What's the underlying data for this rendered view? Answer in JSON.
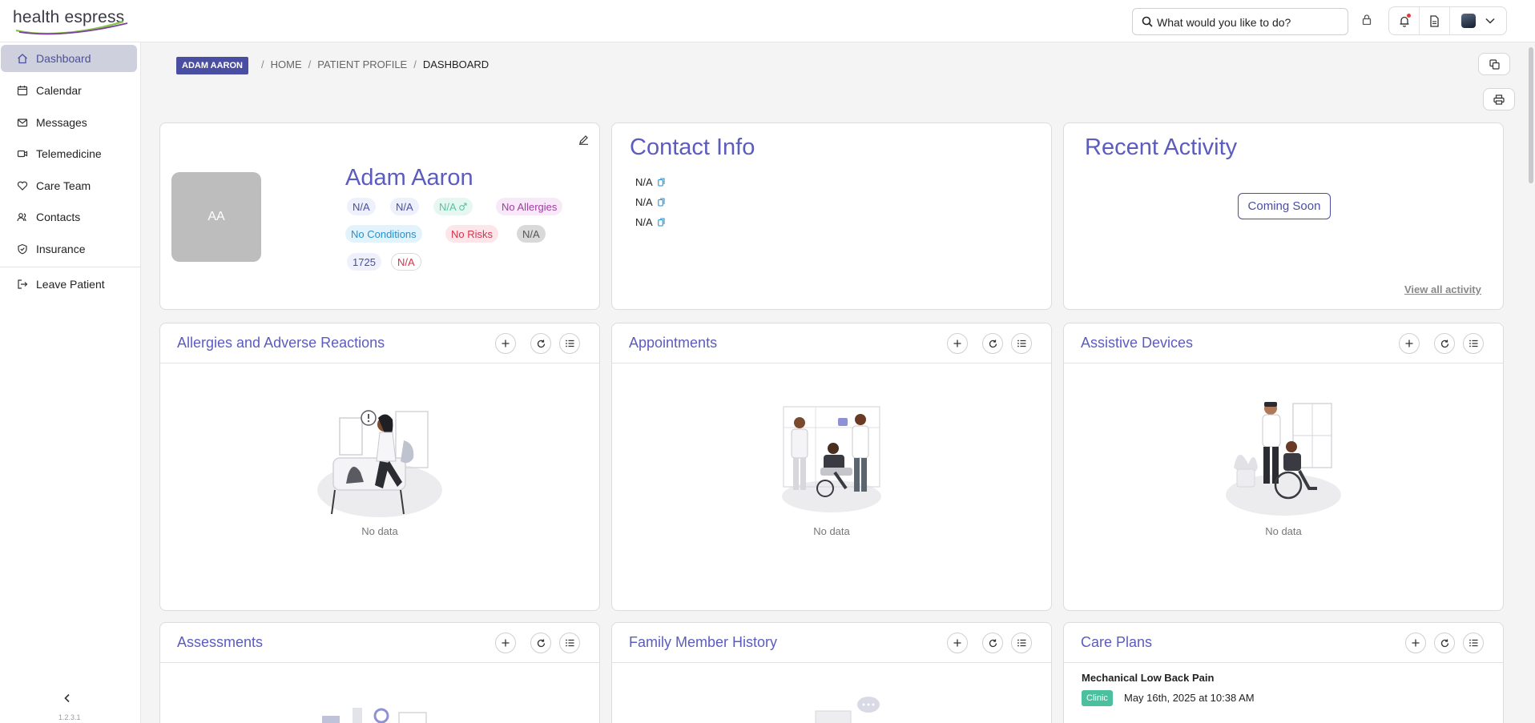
{
  "app": {
    "logo_text": "health espress",
    "version": "1.2.3.1"
  },
  "search": {
    "placeholder": "What would you like to do?"
  },
  "sidebar": {
    "items": [
      {
        "label": "Dashboard",
        "icon": "home-icon",
        "active": true
      },
      {
        "label": "Calendar",
        "icon": "calendar-icon"
      },
      {
        "label": "Messages",
        "icon": "mail-icon"
      },
      {
        "label": "Telemedicine",
        "icon": "video-icon"
      },
      {
        "label": "Care Team",
        "icon": "heart-icon"
      },
      {
        "label": "Contacts",
        "icon": "contacts-icon"
      },
      {
        "label": "Insurance",
        "icon": "shield-icon"
      }
    ],
    "leave": {
      "label": "Leave Patient",
      "icon": "exit-icon"
    }
  },
  "breadcrumb": {
    "patient_badge": "ADAM AARON",
    "items": [
      "HOME",
      "PATIENT PROFILE",
      "DASHBOARD"
    ]
  },
  "profile": {
    "initials": "AA",
    "name": "Adam Aaron",
    "chips": {
      "c1": "N/A",
      "c2": "N/A",
      "c3": "N/A",
      "allergies": "No Allergies",
      "conditions": "No Conditions",
      "risks": "No Risks",
      "c7": "N/A",
      "c8": "1725",
      "c9": "N/A"
    }
  },
  "contact_info": {
    "title": "Contact Info",
    "rows": [
      "N/A",
      "N/A",
      "N/A"
    ]
  },
  "recent_activity": {
    "title": "Recent Activity",
    "coming_soon": "Coming Soon",
    "view_all": "View all activity"
  },
  "widgets": {
    "allergies": {
      "title": "Allergies and Adverse Reactions",
      "empty": "No data"
    },
    "appointments": {
      "title": "Appointments",
      "empty": "No data"
    },
    "assistive": {
      "title": "Assistive Devices",
      "empty": "No data"
    },
    "assessments": {
      "title": "Assessments"
    },
    "family": {
      "title": "Family Member History"
    },
    "care_plans": {
      "title": "Care Plans",
      "item_title": "Mechanical Low Back Pain",
      "item_badge": "Clinic",
      "item_date": "May 16th, 2025 at 10:38 AM"
    }
  },
  "colors": {
    "accent": "#5c5cbf",
    "badge": "#4a4ea3",
    "active_nav": "#cfd0de",
    "clinic_badge": "#4bbf9e"
  }
}
